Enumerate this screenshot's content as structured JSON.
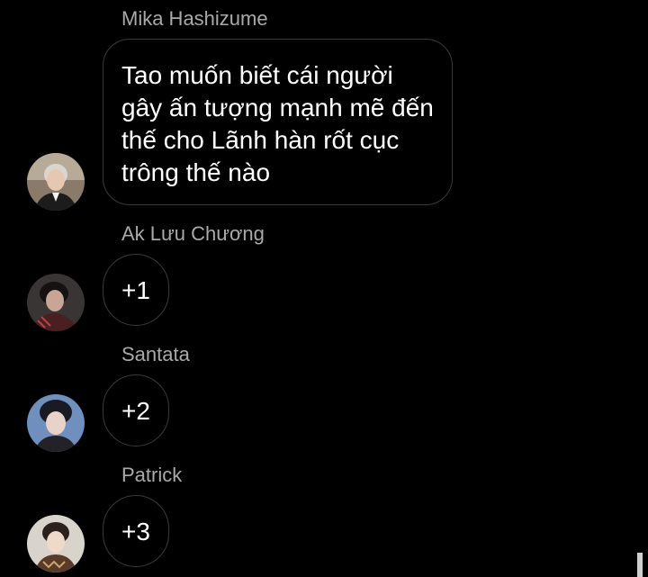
{
  "messages": [
    {
      "sender": "Mika Hashizume",
      "text": "Tao muốn biết cái người gây ấn tượng mạnh mẽ đến thế cho Lãnh hàn rốt cục trông thế nào"
    },
    {
      "sender": "Ak Lưu Chương",
      "text": "+1"
    },
    {
      "sender": "Santata",
      "text": "+2"
    },
    {
      "sender": "Patrick",
      "text": "+3"
    }
  ],
  "colors": {
    "background": "#000000",
    "sender_name": "#a9a9a9",
    "bubble_border": "#3a3a3a",
    "message_text": "#ffffff"
  }
}
